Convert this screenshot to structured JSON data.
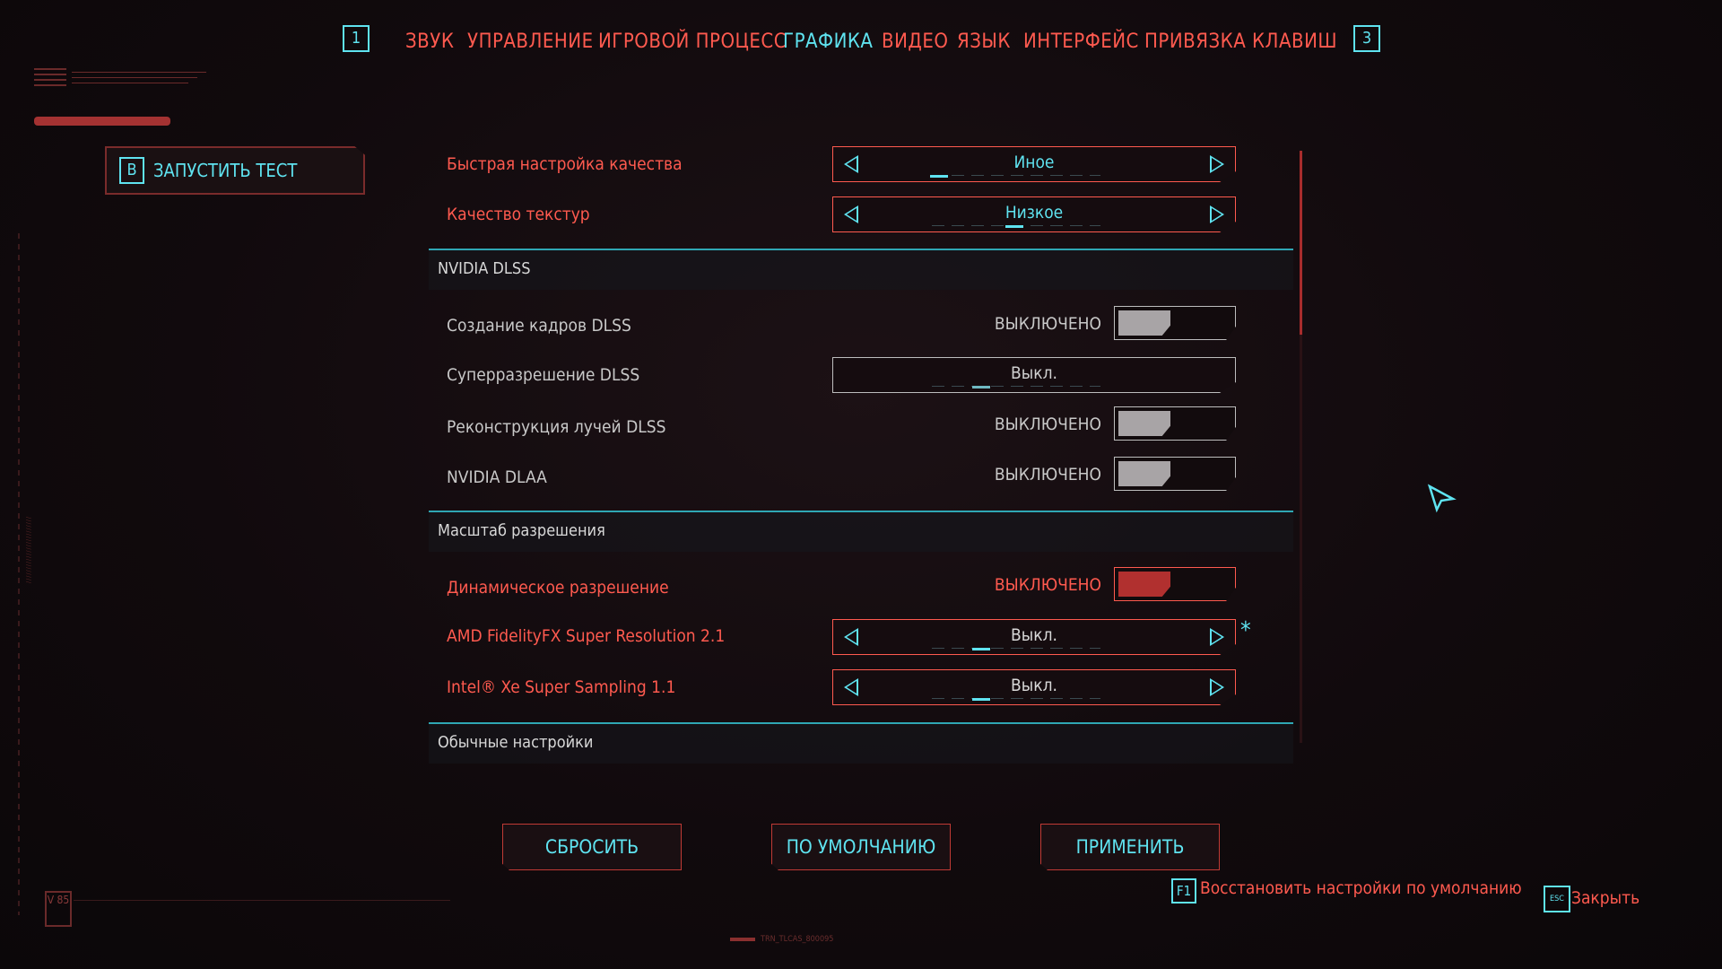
{
  "nav": {
    "prev_key": "1",
    "next_key": "3",
    "tabs": [
      {
        "label": "ЗВУК",
        "active": false
      },
      {
        "label": "УПРАВЛЕНИЕ",
        "active": false
      },
      {
        "label": "ИГРОВОЙ ПРОЦЕСС",
        "active": false
      },
      {
        "label": "ГРАФИКА",
        "active": true
      },
      {
        "label": "ВИДЕО",
        "active": false
      },
      {
        "label": "ЯЗЫК",
        "active": false
      },
      {
        "label": "ИНТЕРФЕЙС",
        "active": false
      },
      {
        "label": "ПРИВЯЗКА КЛАВИШ",
        "active": false
      }
    ]
  },
  "launch_test": {
    "key": "B",
    "label": "ЗАПУСТИТЬ ТЕСТ"
  },
  "settings": {
    "quick_preset": {
      "label": "Быстрая настройка качества",
      "value": "Иное"
    },
    "texture_quality": {
      "label": "Качество текстур",
      "value": "Низкое"
    },
    "section_dlss": "NVIDIA DLSS",
    "dlss_frame_gen": {
      "label": "Создание кадров DLSS",
      "state": "ВЫКЛЮЧЕНО"
    },
    "dlss_super_res": {
      "label": "Суперразрешение DLSS",
      "value": "Выкл."
    },
    "dlss_ray_recon": {
      "label": "Реконструкция лучей DLSS",
      "state": "ВЫКЛЮЧЕНО"
    },
    "nvidia_dlaa": {
      "label": "NVIDIA DLAA",
      "state": "ВЫКЛЮЧЕНО"
    },
    "section_res_scale": "Масштаб разрешения",
    "dynamic_res": {
      "label": "Динамическое разрешение",
      "state": "ВЫКЛЮЧЕНО"
    },
    "fsr": {
      "label": "AMD FidelityFX Super Resolution 2.1",
      "value": "Выкл.",
      "marker": "*"
    },
    "xess": {
      "label": "Intel® Xe Super Sampling 1.1",
      "value": "Выкл."
    },
    "section_basic": "Обычные настройки"
  },
  "buttons": {
    "reset": "СБРОСИТЬ",
    "default": "ПО УМОЛЧАНИЮ",
    "apply": "ПРИМЕНИТЬ"
  },
  "hints": {
    "restore_key": "F1",
    "restore_label": "Восстановить настройки по умолчанию",
    "close_key": "ESC",
    "close_label": "Закрыть"
  },
  "decor": {
    "badge": "V 85",
    "footer_code": "TRN_TLCAS_800095"
  },
  "colors": {
    "accent_cyan": "#5fe3f0",
    "accent_red": "#ff5a4f",
    "section_line": "#2fa7b4"
  }
}
